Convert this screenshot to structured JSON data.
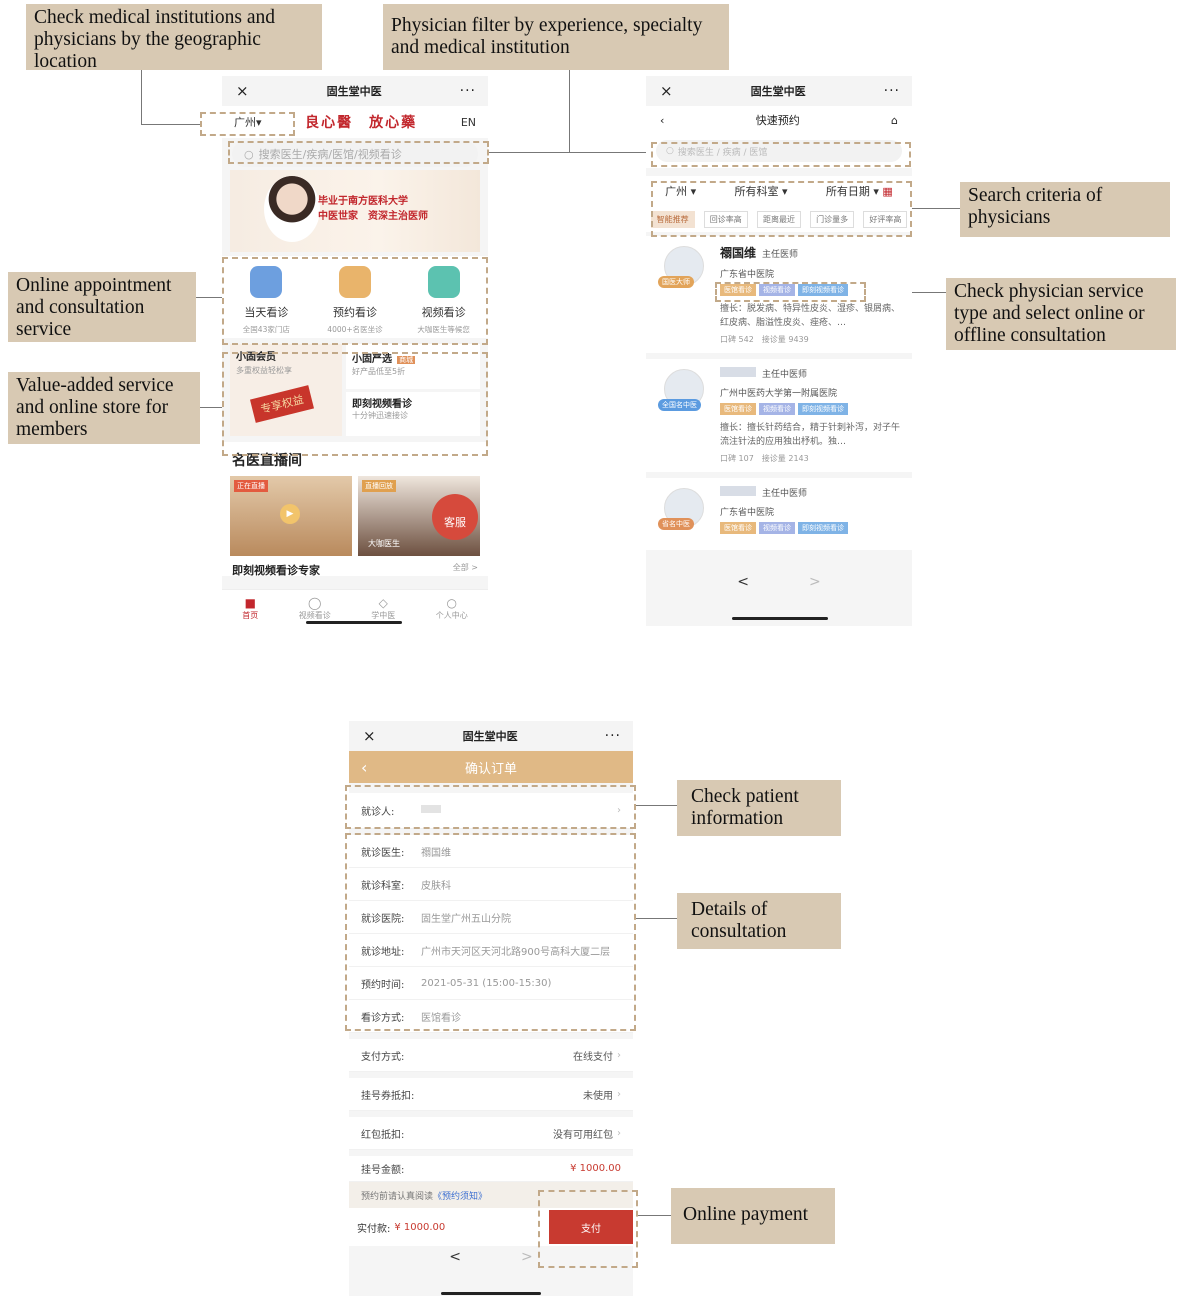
{
  "annotations": {
    "geo": "Check medical institutions and physicians by the geographic location",
    "filter": "Physician filter by experience, specialty and medical institution",
    "appointment": "Online appointment and consultation service",
    "value_added": "Value-added service and online store for members",
    "search_criteria": "Search criteria of physicians",
    "service_type": "Check physician service type and select online or offline consultation",
    "patient": "Check patient information",
    "details": "Details of consultation",
    "payment": "Online payment"
  },
  "window": {
    "title": "固生堂中医",
    "close": "×",
    "more": "···"
  },
  "home": {
    "city": "广州▾",
    "slogan": "良心醫　放心藥",
    "lang": "EN",
    "search_placeholder": "搜索医生/疾病/医馆/视频看诊",
    "banner": {
      "line1": "毕业于南方医科大学",
      "line2": "中医世家　资深主治医师"
    },
    "services": [
      {
        "label": "当天看诊",
        "sub": "全国43家门店",
        "color": "#6d9fdf"
      },
      {
        "label": "预约看诊",
        "sub": "4000+名医坐诊",
        "color": "#e9b46b"
      },
      {
        "label": "视频看诊",
        "sub": "大咖医生等候您",
        "color": "#5cc2b0"
      }
    ],
    "member": {
      "title": "小固会员",
      "sub": "多重权益轻松享",
      "badge": "专享权益"
    },
    "store": {
      "title": "小固严选",
      "tag": "商城",
      "sub": "好产品低至5折"
    },
    "video": {
      "title": "即刻视频看诊",
      "sub": "十分钟迅速接诊"
    },
    "live_title": "名医直播间",
    "live_badge_1": "正在直播",
    "live_badge_2": "直播回放",
    "live_caption_2": "大咖医生",
    "service_float": "客服",
    "video_experts": "即刻视频看诊专家",
    "all": "全部 >",
    "tabs": [
      "首页",
      "视频看诊",
      "学中医",
      "个人中心"
    ]
  },
  "search": {
    "nav_title": "快速预约",
    "placeholder": "搜索医生 / 疾病 / 医馆",
    "filters": [
      "广州",
      "所有科室",
      "所有日期"
    ],
    "sorts": [
      "智能推荐",
      "回诊率高",
      "距离最近",
      "门诊量多",
      "好评率高"
    ],
    "doctors": [
      {
        "name": "禤国维",
        "title": "主任医师",
        "badge": "国医大师",
        "hospital": "广东省中医院",
        "tags": [
          "医馆看诊",
          "视频看诊",
          "即刻视频看诊"
        ],
        "specialty": "擅长：脱发病、特异性皮炎、湿疹、银屑病、红皮病、脂溢性皮炎、痤疮、…",
        "stats": "口碑 542　接诊量 9439"
      },
      {
        "name": "",
        "title": "主任中医师",
        "badge": "全国名中医",
        "hospital": "广州中医药大学第一附属医院",
        "tags": [
          "医馆看诊",
          "视频看诊",
          "即刻视频看诊"
        ],
        "specialty": "擅长：擅长针药结合，精于针刺补泻，对子午流注针法的应用独出杼机。独…",
        "stats": "口碑 107　接诊量 2143"
      },
      {
        "name": "",
        "title": "主任中医师",
        "badge": "省名中医",
        "hospital": "广东省中医院",
        "tags": [
          "医馆看诊",
          "视频看诊",
          "即刻视频看诊"
        ],
        "specialty": "",
        "stats": ""
      }
    ],
    "prev": "<",
    "next": ">"
  },
  "order": {
    "title": "确认订单",
    "patient_label": "就诊人:",
    "patient_value": "",
    "rows": [
      {
        "k": "就诊医生:",
        "v": "禤国维"
      },
      {
        "k": "就诊科室:",
        "v": "皮肤科"
      },
      {
        "k": "就诊医院:",
        "v": "固生堂广州五山分院"
      },
      {
        "k": "就诊地址:",
        "v": "广州市天河区天河北路900号高科大厦二层"
      },
      {
        "k": "预约时间:",
        "v": "2021-05-31 (15:00-15:30)"
      },
      {
        "k": "看诊方式:",
        "v": "医馆看诊"
      }
    ],
    "pay_method_label": "支付方式:",
    "pay_method_value": "在线支付",
    "coupon_label": "挂号券抵扣:",
    "coupon_value": "未使用",
    "redpacket_label": "红包抵扣:",
    "redpacket_value": "没有可用红包",
    "fee_label": "挂号金额:",
    "fee_value": "¥ 1000.00",
    "notice_prefix": "预约前请认真阅读",
    "notice_link": "《预约须知》",
    "paid_label": "实付款:",
    "paid_value": "¥ 1000.00",
    "pay_button": "支付",
    "prev": "<",
    "next": ">"
  },
  "colors": {
    "accent_tan": "#d8c9b3",
    "order_header": "#e0b986",
    "pay_red": "#c83a30",
    "brand_red": "#c2272d"
  }
}
